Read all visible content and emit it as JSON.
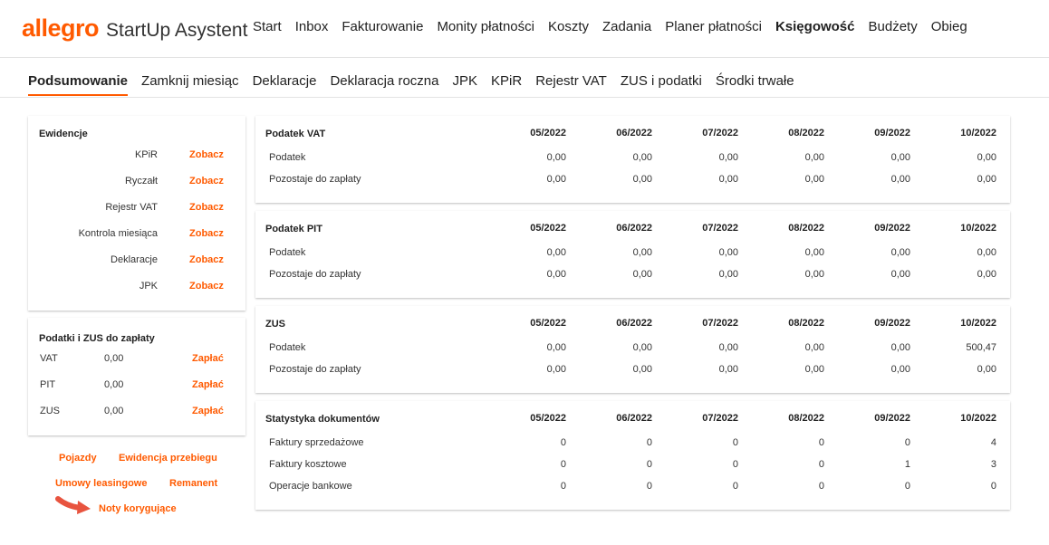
{
  "header": {
    "brand": "allegro",
    "product": "StartUp Asystent",
    "nav": [
      "Start",
      "Inbox",
      "Fakturowanie",
      "Monity płatności",
      "Koszty",
      "Zadania",
      "Planer płatności",
      "Księgowość",
      "Budżety",
      "Obieg"
    ],
    "nav_active_index": 7
  },
  "subnav": {
    "items": [
      "Podsumowanie",
      "Zamknij miesiąc",
      "Deklaracje",
      "Deklaracja roczna",
      "JPK",
      "KPiR",
      "Rejestr VAT",
      "ZUS i podatki",
      "Środki trwałe"
    ],
    "active_index": 0
  },
  "ewidencje": {
    "title": "Ewidencje",
    "link_label": "Zobacz",
    "items": [
      "KPiR",
      "Ryczałt",
      "Rejestr VAT",
      "Kontrola miesiąca",
      "Deklaracje",
      "JPK"
    ]
  },
  "taxes": {
    "title": "Podatki i ZUS do zapłaty",
    "link_label": "Zapłać",
    "items": [
      {
        "label": "VAT",
        "value": "0,00"
      },
      {
        "label": "PIT",
        "value": "0,00"
      },
      {
        "label": "ZUS",
        "value": "0,00"
      }
    ]
  },
  "extra_links": {
    "pojazdy": "Pojazdy",
    "ewidencja_przebiegu": "Ewidencja przebiegu",
    "umowy_leasingowe": "Umowy leasingowe",
    "remanent": "Remanent",
    "noty_korygujace": "Noty korygujące"
  },
  "months": [
    "05/2022",
    "06/2022",
    "07/2022",
    "08/2022",
    "09/2022",
    "10/2022"
  ],
  "tables": [
    {
      "title": "Podatek VAT",
      "rows": [
        {
          "label": "Podatek",
          "values": [
            "0,00",
            "0,00",
            "0,00",
            "0,00",
            "0,00",
            "0,00"
          ]
        },
        {
          "label": "Pozostaje do zapłaty",
          "values": [
            "0,00",
            "0,00",
            "0,00",
            "0,00",
            "0,00",
            "0,00"
          ]
        }
      ]
    },
    {
      "title": "Podatek PIT",
      "rows": [
        {
          "label": "Podatek",
          "values": [
            "0,00",
            "0,00",
            "0,00",
            "0,00",
            "0,00",
            "0,00"
          ]
        },
        {
          "label": "Pozostaje do zapłaty",
          "values": [
            "0,00",
            "0,00",
            "0,00",
            "0,00",
            "0,00",
            "0,00"
          ]
        }
      ]
    },
    {
      "title": "ZUS",
      "rows": [
        {
          "label": "Podatek",
          "values": [
            "0,00",
            "0,00",
            "0,00",
            "0,00",
            "0,00",
            "500,47"
          ]
        },
        {
          "label": "Pozostaje do zapłaty",
          "values": [
            "0,00",
            "0,00",
            "0,00",
            "0,00",
            "0,00",
            "0,00"
          ]
        }
      ]
    },
    {
      "title": "Statystyka dokumentów",
      "rows": [
        {
          "label": "Faktury sprzedażowe",
          "values": [
            "0",
            "0",
            "0",
            "0",
            "0",
            "4"
          ]
        },
        {
          "label": "Faktury kosztowe",
          "values": [
            "0",
            "0",
            "0",
            "0",
            "1",
            "3"
          ]
        },
        {
          "label": "Operacje bankowe",
          "values": [
            "0",
            "0",
            "0",
            "0",
            "0",
            "0"
          ]
        }
      ]
    }
  ],
  "colors": {
    "accent": "#ff5a00",
    "arrow": "#e8543f"
  },
  "icons": {
    "pointer_arrow": "arrow-icon"
  }
}
